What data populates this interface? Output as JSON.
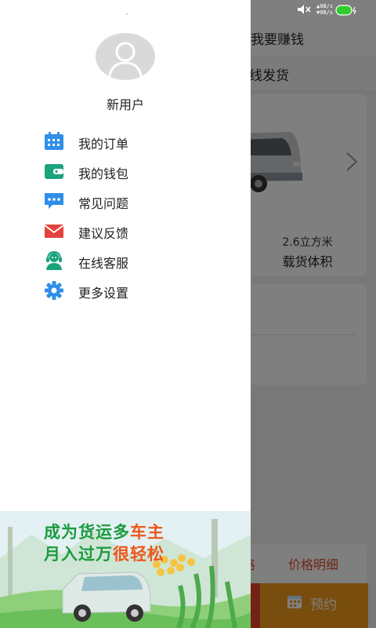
{
  "background": {
    "header_title": "我要赚钱",
    "subbar_text": "线发货",
    "volume_value": "2.6立方米",
    "volume_label": "载货体积",
    "foot_left": "格",
    "price_detail": "价格明细",
    "book_label": "预约"
  },
  "status_bar": {
    "net_up": "▲0B/s",
    "net_down": "▼0B/s"
  },
  "drawer": {
    "username": "新用户",
    "menu": [
      {
        "label": "我的订单",
        "icon": "calendar-icon"
      },
      {
        "label": "我的钱包",
        "icon": "wallet-icon"
      },
      {
        "label": "常见问题",
        "icon": "chat-icon"
      },
      {
        "label": "建议反馈",
        "icon": "mail-icon"
      },
      {
        "label": "在线客服",
        "icon": "headset-icon"
      },
      {
        "label": "更多设置",
        "icon": "gear-icon"
      }
    ],
    "banner": {
      "line1_a": "成为货运多",
      "line1_b": "车主",
      "line2_a": "月入过万",
      "line2_b": "很轻松"
    }
  },
  "colors": {
    "icon_blue": "#2f8fe8",
    "icon_green": "#1aa37c",
    "icon_red": "#e2423b",
    "banner_green": "#1d9b3f",
    "banner_orange": "#f0561a"
  }
}
